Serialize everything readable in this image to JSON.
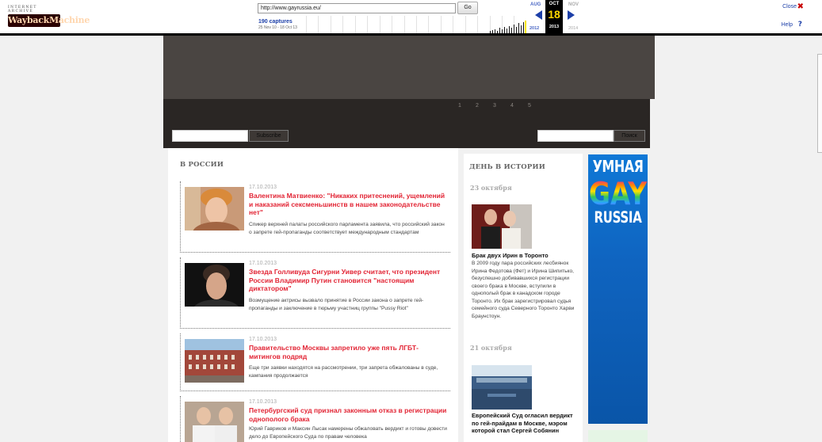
{
  "wayback": {
    "logo_top": "INTERNET ARCHIVE",
    "logo_main": "WaybackMachine",
    "url": "http://www.gayrussia.eu/",
    "go_label": "Go",
    "captures_count": "190 captures",
    "captures_range": "25 Nov 10 - 18 Oct 13",
    "prev_month": "AUG",
    "current_month": "OCT",
    "next_month": "NOV",
    "current_day": "18",
    "prev_year": "2012",
    "current_year": "2013",
    "next_year": "2014",
    "close_label": "Close",
    "help_label": "Help"
  },
  "header": {
    "slides": [
      "1",
      "2",
      "3",
      "4",
      "5"
    ],
    "subscribe_label": "Subscribe",
    "search_label": "Поиск"
  },
  "main": {
    "section_title": "В РОССИИ",
    "articles": [
      {
        "date": "17.10.2013",
        "headline": "Валентина Матвиенко: \"Никаких притеснений, ущемлений и наказаний сексменьшинств в нашем законодательстве нет\"",
        "summary": "Спикер верхней палаты российского парламента заявила, что российский закон о запрете гей-пропаганды соответствует международным стандартам"
      },
      {
        "date": "17.10.2013",
        "headline": "Звезда Голливуда Сигурни Уивер считает, что президент России Владимир Путин становится \"настоящим диктатором\"",
        "summary": "Возмущение актрисы вызвало принятие в России закона о запрете гей-пропаганды и заключение в тюрьму участниц группы \"Pussy Riot\""
      },
      {
        "date": "17.10.2013",
        "headline": "Правительство Москвы запретило уже пять ЛГБТ-митингов подряд",
        "summary": "Еще три заявки находятся на рассмотрении, три запрета обжалованы в суде, кампания продолжается"
      },
      {
        "date": "17.10.2013",
        "headline": "Петербургский суд признал законным отказ в регистрации однополого брака",
        "summary": "Юрий Гавриков и Максин Лысак намерены обжаловать вердикт и готовы довести дело до Европейского Суда по правам человека"
      }
    ]
  },
  "history": {
    "section_title": "ДЕНЬ В ИСТОРИИ",
    "entries": [
      {
        "date": "23 октября",
        "title": "Брак двух Ирин в Торонто",
        "body": "В 2009 году пара российских лесбиянок Ирина Федотова (Фет) и Ирина Шипитько, безуспешно добивавшихся регистрации своего брака в Москве, вступили в однополый брак в канадском городе Торонто. Их брак зарегистрировал судья семейного суда Северного Торонто Харви Браунстоун."
      },
      {
        "date": "21 октября",
        "title": "Европейский Суд огласил вердикт по гей-прайдам в Москве, мэром которой стал Сергей Собянин",
        "body": ""
      }
    ]
  },
  "banner": {
    "line1": "УМНАЯ",
    "line2": "GAY",
    "line3": "RUSSIA"
  },
  "colors": {
    "headline_red": "#e22434",
    "wayback_blue": "#1c3fa8",
    "header_dark": "#2a2624",
    "banner_blue": "#0f64c0"
  }
}
